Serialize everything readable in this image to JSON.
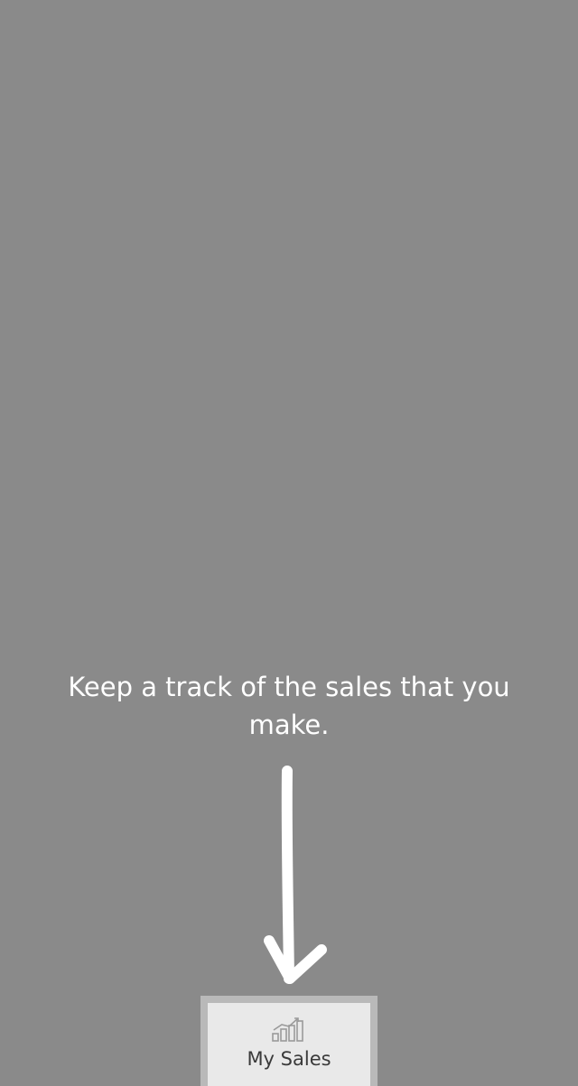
{
  "tooltip": {
    "text": "Keep a track of the sales that you make."
  },
  "bottom_nav": {
    "highlighted_tab": {
      "label": "My Sales",
      "icon": "bar-chart-trend-icon"
    }
  },
  "colors": {
    "overlay": "#8a8a8a",
    "tip_text": "#ffffff",
    "tab_background": "#e9e9e9",
    "tab_border": "#b9b9b9",
    "tab_label": "#3a3a3a"
  }
}
